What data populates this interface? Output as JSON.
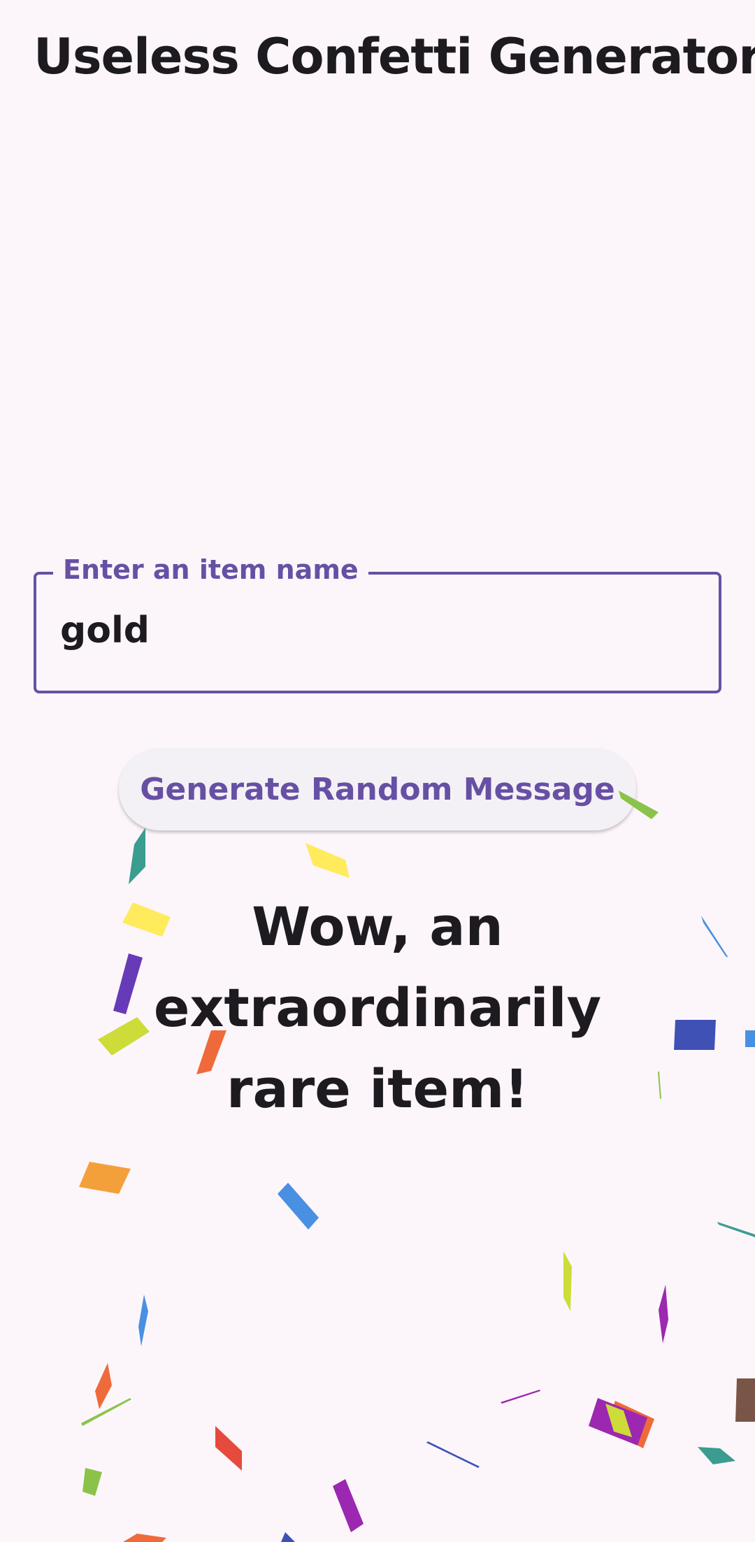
{
  "app": {
    "title": "Useless Confetti Generator"
  },
  "input": {
    "label": "Enter an item name",
    "value": "gold"
  },
  "button": {
    "label": "Generate Random Message"
  },
  "message": {
    "line1": "Wow, an extraordinarily",
    "line2": "rare item!"
  },
  "theme": {
    "primary": "#6750a4",
    "background": "#fcf6fb",
    "text": "#1d1b20"
  },
  "confetti_colors": [
    "#3a9d8f",
    "#ffeb5c",
    "#673ab7",
    "#cddc39",
    "#ef6a3a",
    "#f4a03a",
    "#4a90e2",
    "#8bc34a",
    "#3f51b5",
    "#9c27b0",
    "#795548",
    "#e64a3c"
  ]
}
